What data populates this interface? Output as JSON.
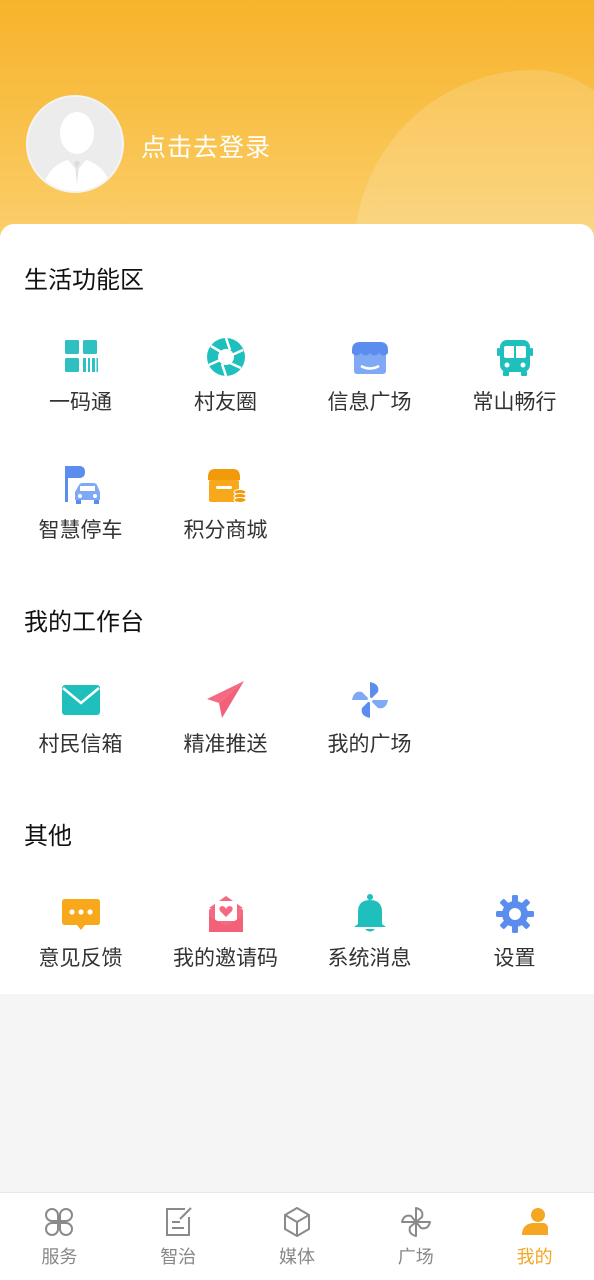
{
  "header": {
    "login_text": "点击去登录"
  },
  "sections": {
    "life": {
      "title": "生活功能区",
      "items": [
        {
          "label": "一码通",
          "icon": "qrcode-icon"
        },
        {
          "label": "村友圈",
          "icon": "aperture-icon"
        },
        {
          "label": "信息广场",
          "icon": "storefront-icon"
        },
        {
          "label": "常山畅行",
          "icon": "bus-icon"
        },
        {
          "label": "智慧停车",
          "icon": "parking-car-icon"
        },
        {
          "label": "积分商城",
          "icon": "points-shop-icon"
        }
      ]
    },
    "workbench": {
      "title": "我的工作台",
      "items": [
        {
          "label": "村民信箱",
          "icon": "mail-icon"
        },
        {
          "label": "精准推送",
          "icon": "paper-plane-icon"
        },
        {
          "label": "我的广场",
          "icon": "pinwheel-icon"
        }
      ]
    },
    "other": {
      "title": "其他",
      "items": [
        {
          "label": "意见反馈",
          "icon": "feedback-icon"
        },
        {
          "label": "我的邀请码",
          "icon": "invitation-icon"
        },
        {
          "label": "系统消息",
          "icon": "bell-icon"
        },
        {
          "label": "设置",
          "icon": "gear-icon"
        }
      ]
    }
  },
  "tabbar": {
    "active_color": "#f5a623",
    "items": [
      {
        "label": "服务",
        "icon": "services-icon"
      },
      {
        "label": "智治",
        "icon": "governance-icon"
      },
      {
        "label": "媒体",
        "icon": "media-cube-icon"
      },
      {
        "label": "广场",
        "icon": "pinwheel-icon"
      },
      {
        "label": "我的",
        "icon": "profile-icon",
        "active": true
      }
    ]
  }
}
